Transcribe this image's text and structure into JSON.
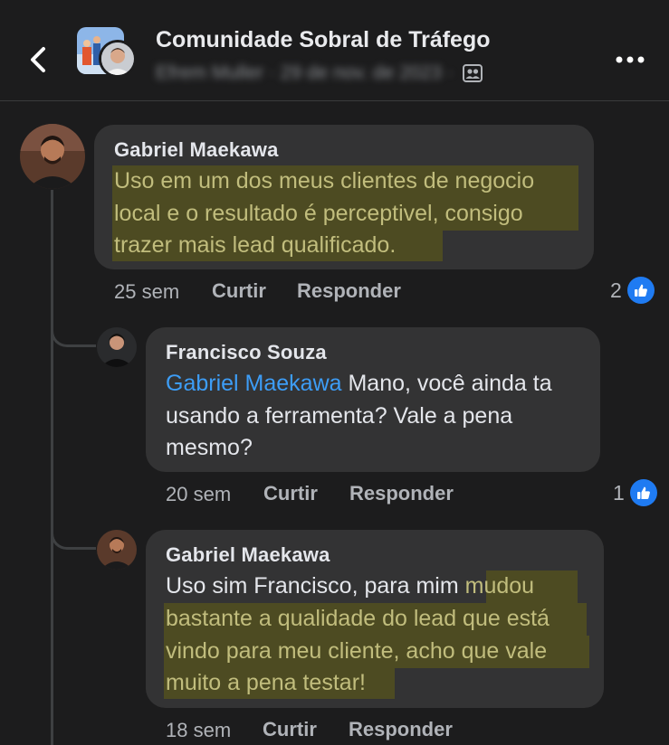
{
  "header": {
    "title": "Comunidade Sobral de Tráfego",
    "subtitle_blurred": "Efrem Muller · 29 de nov. de 2023 ·"
  },
  "comments": [
    {
      "author": "Gabriel Maekawa",
      "lines": [
        "Uso em um dos meus clientes de negocio",
        "local e o resultado é perceptivel, consigo",
        "trazer mais lead qualificado."
      ],
      "time": "25 sem",
      "like_label": "Curtir",
      "reply_label": "Responder",
      "reactions": "2"
    },
    {
      "author": "Francisco Souza",
      "mention": "Gabriel Maekawa",
      "line1_rest": " Mano, você ainda ta",
      "lines": [
        "usando a ferramenta? Vale a pena",
        "mesmo?"
      ],
      "time": "20 sem",
      "like_label": "Curtir",
      "reply_label": "Responder",
      "reactions": "1"
    },
    {
      "author": "Gabriel Maekawa",
      "line1_plain": "Uso sim Francisco, para mim ",
      "line1_hl": "mudou",
      "lines": [
        "bastante a qualidade do lead que está",
        "vindo para meu cliente, acho que vale",
        "muito a pena testar!"
      ],
      "time": "18 sem",
      "like_label": "Curtir",
      "reply_label": "Responder"
    }
  ],
  "colors": {
    "background": "#1c1c1d",
    "bubble": "#333334",
    "highlight_bg": "#4d4b22",
    "highlight_text": "#c1bd7d",
    "mention": "#3d9df6",
    "like_blue": "#1f7bf2",
    "muted": "#b0b3b8"
  },
  "icons": {
    "back": "chevron-left-icon",
    "more": "more-horizontal-icon",
    "group_privacy": "group-members-icon",
    "like": "thumbs-up-icon"
  }
}
